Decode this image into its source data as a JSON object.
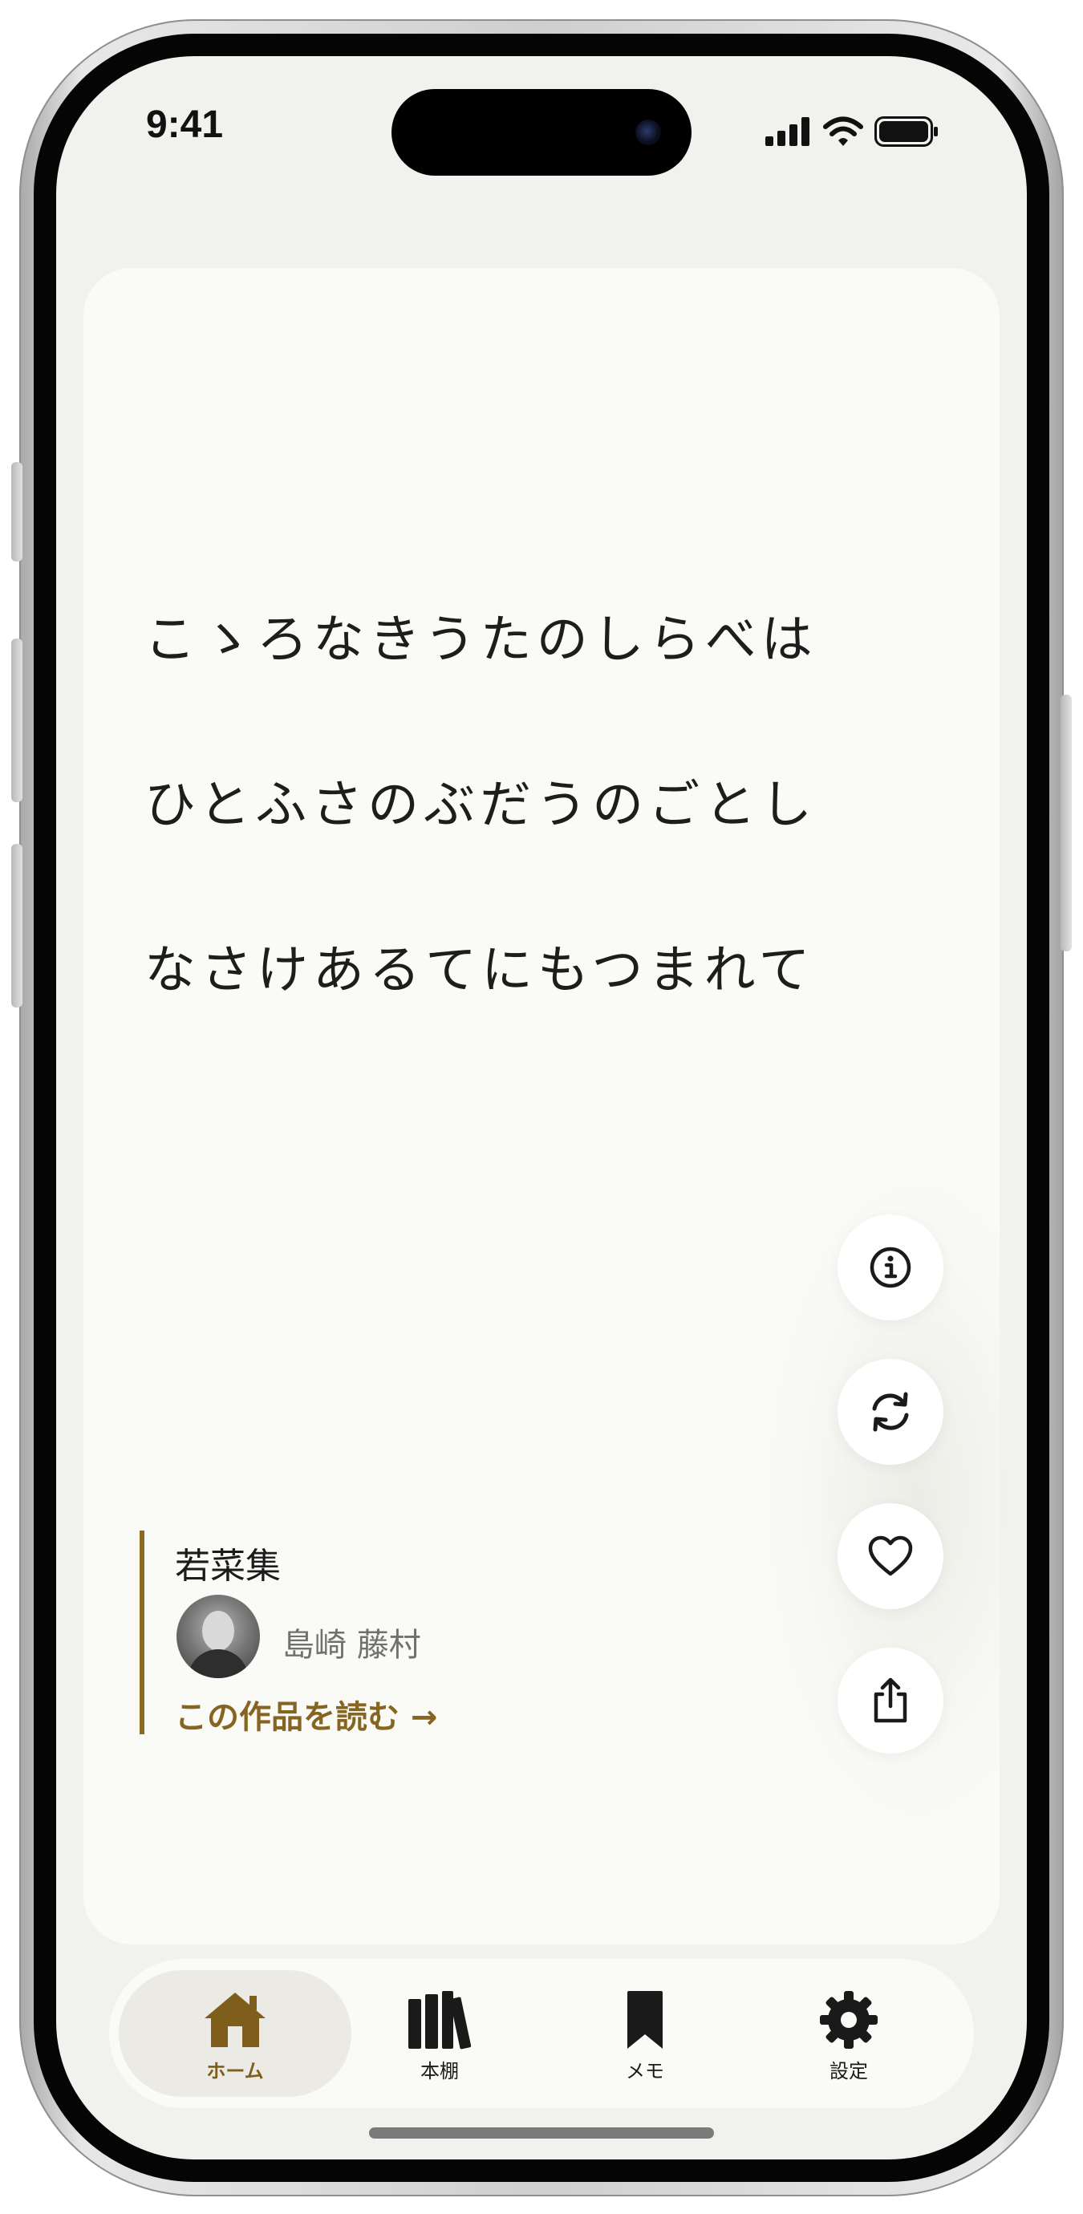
{
  "status_bar": {
    "time": "9:41"
  },
  "poem": {
    "lines": [
      "こゝろなきうたのしらべは",
      "ひとふさのぶだうのごとし",
      "なさけあるてにもつまれて"
    ]
  },
  "work": {
    "title": "若菜集",
    "author": "島崎 藤村",
    "read_link": "この作品を読む →"
  },
  "actions": [
    {
      "icon": "info-icon"
    },
    {
      "icon": "refresh-icon"
    },
    {
      "icon": "heart-icon"
    },
    {
      "icon": "share-icon"
    }
  ],
  "tabs": [
    {
      "label": "ホーム",
      "icon": "home-icon",
      "active": true
    },
    {
      "label": "本棚",
      "icon": "bookshelf-icon",
      "active": false
    },
    {
      "label": "メモ",
      "icon": "bookmark-icon",
      "active": false
    },
    {
      "label": "設定",
      "icon": "gear-icon",
      "active": false
    }
  ],
  "colors": {
    "accent": "#866522",
    "background": "#f1f1ee",
    "card": "#fafaf6"
  }
}
